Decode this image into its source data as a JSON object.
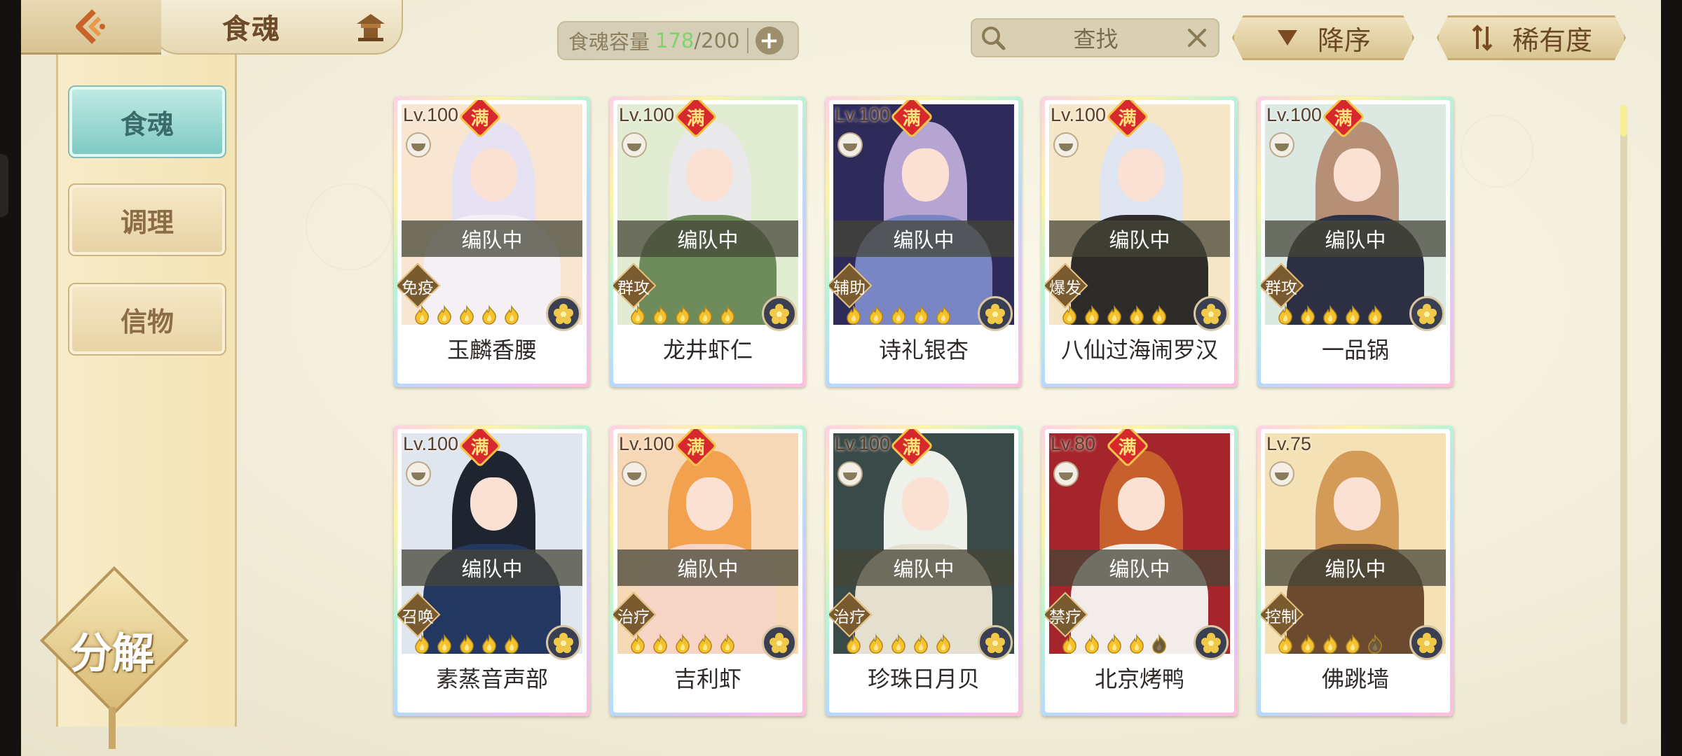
{
  "header": {
    "title": "食魂",
    "capacity_label": "食魂容量",
    "capacity_current": "178",
    "capacity_max": "/200",
    "search_placeholder": "查找",
    "sort_order_label": "降序",
    "sort_rarity_label": "稀有度"
  },
  "sidebar": {
    "items": [
      {
        "label": "食魂",
        "active": true
      },
      {
        "label": "调理",
        "active": false
      },
      {
        "label": "信物",
        "active": false
      }
    ],
    "decompose_label": "分解"
  },
  "cards": [
    {
      "level": "Lv.100",
      "full": "满",
      "team": "编队中",
      "role": "免疫",
      "name": "玉麟香腰",
      "stars": 5,
      "hair": "#e6e2f4",
      "body": "#f4f0f4",
      "bg": "#f8e6d2"
    },
    {
      "level": "Lv.100",
      "full": "满",
      "team": "编队中",
      "role": "群攻",
      "name": "龙井虾仁",
      "stars": 5,
      "hair": "#e9e8ea",
      "body": "#6d8b5b",
      "bg": "#e2ecd2"
    },
    {
      "level": "Lv.100",
      "full": "满",
      "team": "编队中",
      "role": "辅助",
      "name": "诗礼银杏",
      "stars": 5,
      "hair": "#b6a4d2",
      "body": "#7a86c4",
      "bg": "#2e2a5a"
    },
    {
      "level": "Lv.100",
      "full": "满",
      "team": "编队中",
      "role": "爆发",
      "name": "八仙过海闹罗汉",
      "stars": 5,
      "hair": "#dfe6f1",
      "body": "#2e2b2b",
      "bg": "#f6e6c8"
    },
    {
      "level": "Lv.100",
      "full": "满",
      "team": "编队中",
      "role": "群攻",
      "name": "一品锅",
      "stars": 5,
      "hair": "#b59077",
      "body": "#2c3042",
      "bg": "#dce8e2"
    },
    {
      "level": "Lv.100",
      "full": "满",
      "team": "编队中",
      "role": "召唤",
      "name": "素蒸音声部",
      "stars": 5,
      "hair": "#1f2431",
      "body": "#243760",
      "bg": "#dfe6ee"
    },
    {
      "level": "Lv.100",
      "full": "满",
      "team": "编队中",
      "role": "治疗",
      "name": "吉利虾",
      "stars": 5,
      "hair": "#f2a24e",
      "body": "#f6d4c6",
      "bg": "#f6d8b6"
    },
    {
      "level": "Lv.100",
      "full": "满",
      "team": "编队中",
      "role": "治疗",
      "name": "珍珠日月贝",
      "stars": 5,
      "hair": "#eef0ea",
      "body": "#e4dfcf",
      "bg": "#3a4a48"
    },
    {
      "level": "Lv.80",
      "full": "满",
      "team": "编队中",
      "role": "禁疗",
      "name": "北京烤鸭",
      "stars": 4,
      "hair": "#c8602e",
      "body": "#f2ecea",
      "bg": "#a4262c"
    },
    {
      "level": "Lv.75",
      "full": "",
      "team": "编队中",
      "role": "控制",
      "name": "佛跳墙",
      "stars": 4,
      "hair": "#d49a58",
      "body": "#6b4a30",
      "bg": "#f4e2b6"
    }
  ],
  "icons": {
    "back": "back-arrow-icon",
    "home": "pavilion-icon",
    "search": "search-icon",
    "clear": "close-icon",
    "sort_desc": "triangle-down-icon",
    "sort_rarity": "sort-arrows-icon",
    "star": "flame-star-icon",
    "element": "flower-element-icon",
    "bowl": "bowl-icon"
  },
  "colors": {
    "capacity_current": "#7fd36b",
    "active_tab": "#7fc9c4",
    "full_badge": "#d6282d"
  }
}
